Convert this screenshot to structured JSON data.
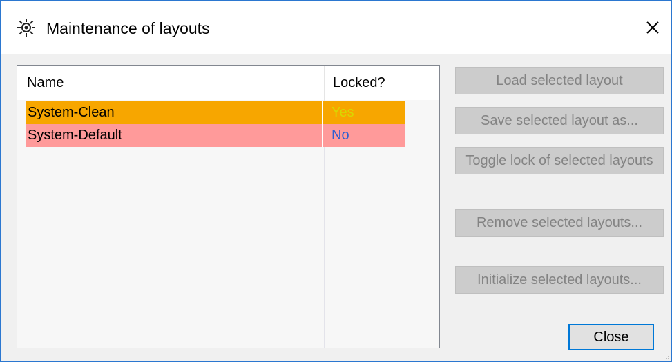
{
  "window": {
    "title": "Maintenance of layouts",
    "icon": "gear-icon",
    "close_icon": "close-icon"
  },
  "table": {
    "columns": [
      "Name",
      "Locked?"
    ],
    "rows": [
      {
        "name": "System-Clean",
        "locked": "Yes",
        "bg": "#f7a600",
        "locked_color": "#d8d800"
      },
      {
        "name": "System-Default",
        "locked": "No",
        "bg": "#ff9a9a",
        "locked_color": "#2f5fcf"
      }
    ]
  },
  "buttons": {
    "load": "Load selected layout",
    "save": "Save selected layout as...",
    "toggle_lock": "Toggle lock of selected layouts",
    "remove": "Remove selected layouts...",
    "initialize": "Initialize selected layouts...",
    "close": "Close"
  },
  "colors": {
    "accent": "#0078d7",
    "window_border": "#2b77d0",
    "disabled_button_bg": "#cccccc",
    "disabled_button_text": "#838383"
  }
}
